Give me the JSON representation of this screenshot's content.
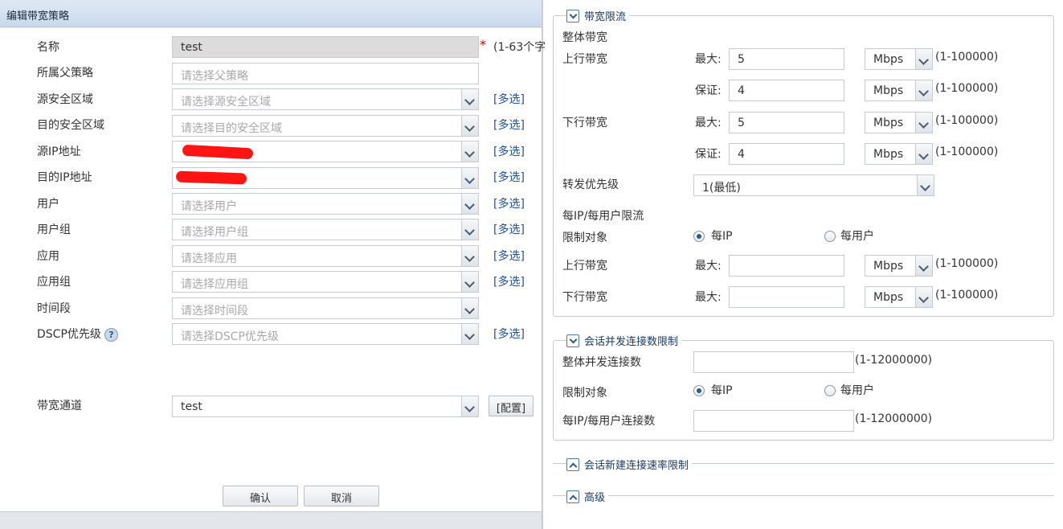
{
  "dialog": {
    "title": "编辑带宽策略",
    "fields": [
      {
        "label": "名称",
        "value": "test",
        "placeholder": ""
      },
      {
        "label": "所属父策略",
        "value": "",
        "placeholder": "请选择父策略"
      },
      {
        "label": "源安全区域",
        "value": "",
        "placeholder": "请选择源安全区域"
      },
      {
        "label": "目的安全区域",
        "value": "",
        "placeholder": "请选择目的安全区域"
      },
      {
        "label": "源IP地址",
        "value": "",
        "placeholder": ""
      },
      {
        "label": "目的IP地址",
        "value": "",
        "placeholder": ""
      },
      {
        "label": "用户",
        "value": "",
        "placeholder": "请选择用户"
      },
      {
        "label": "用户组",
        "value": "",
        "placeholder": "请选择用户组"
      },
      {
        "label": "应用",
        "value": "",
        "placeholder": "请选择应用"
      },
      {
        "label": "应用组",
        "value": "",
        "placeholder": "请选择应用组"
      },
      {
        "label": "时间段",
        "value": "",
        "placeholder": "请选择时间段"
      },
      {
        "label": "DSCP优先级",
        "value": "",
        "placeholder": "请选择DSCP优先级"
      }
    ],
    "name_required_mark": "*",
    "name_hint": "(1-63个字",
    "multi_select_label": "[多选]",
    "help_icon_glyph": "?",
    "channel": {
      "label": "带宽通道",
      "value": "test",
      "config_button": "[配置]"
    },
    "ok_button": "确认",
    "cancel_button": "取消"
  },
  "right": {
    "bandwidth_section": {
      "title": "带宽限流",
      "overall_label": "整体带宽",
      "upstream_label": "上行带宽",
      "downstream_label": "下行带宽",
      "max_label": "最大:",
      "guarantee_label": "保证:",
      "up_max": "5",
      "up_guarantee": "4",
      "down_max": "5",
      "down_guarantee": "4",
      "unit": "Mbps",
      "range_hint": "(1-100000)",
      "priority_label": "转发优先级",
      "priority_value": "1(最低)",
      "per_limit_label": "每IP/每用户限流",
      "limit_target_label": "限制对象",
      "per_ip": "每IP",
      "per_user": "每用户",
      "per_up_max": "",
      "per_down_max": ""
    },
    "session_section": {
      "title": "会话并发连接数限制",
      "overall_label": "整体并发连接数",
      "overall_value": "",
      "range_hint": "(1-12000000)",
      "limit_target_label": "限制对象",
      "per_ip": "每IP",
      "per_user": "每用户",
      "per_conn_label": "每IP/每用户连接数",
      "per_conn_value": ""
    },
    "new_conn_section": {
      "title": "会话新建连接速率限制"
    },
    "advanced_section": {
      "title": "高级"
    }
  },
  "colors": {
    "link": "#1f4fa8",
    "required": "#d40000",
    "title_bar": "#c9d9ec",
    "radio_selected": "#2a5a93"
  }
}
